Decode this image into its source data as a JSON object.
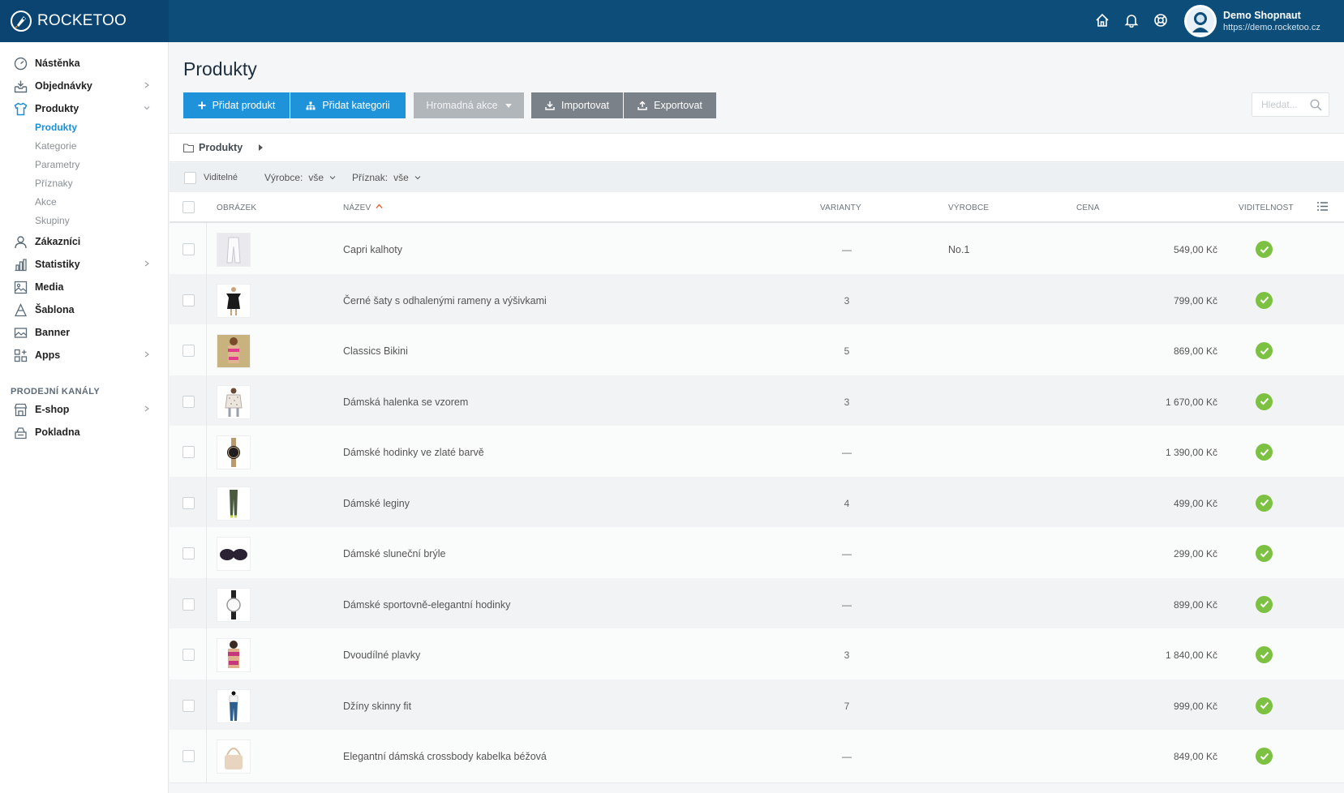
{
  "brand": {
    "name": "ROCKETOO"
  },
  "user": {
    "name": "Demo Shopnaut",
    "url": "https://demo.rocketoo.cz"
  },
  "sidebar": {
    "items": [
      {
        "label": "Nástěnka",
        "icon": "dashboard-icon"
      },
      {
        "label": "Objednávky",
        "icon": "inbox-icon"
      },
      {
        "label": "Produkty",
        "icon": "shirt-icon"
      },
      {
        "label": "Zákazníci",
        "icon": "user-icon"
      },
      {
        "label": "Statistiky",
        "icon": "bar-chart-icon"
      },
      {
        "label": "Media",
        "icon": "image-icon"
      },
      {
        "label": "Šablona",
        "icon": "template-icon"
      },
      {
        "label": "Banner",
        "icon": "banner-icon"
      },
      {
        "label": "Apps",
        "icon": "apps-icon"
      }
    ],
    "sub_items": [
      "Produkty",
      "Kategorie",
      "Parametry",
      "Příznaky",
      "Akce",
      "Skupiny"
    ],
    "channels_title": "PRODEJNÍ KANÁLY",
    "channels": [
      {
        "label": "E-shop",
        "icon": "store-icon"
      },
      {
        "label": "Pokladna",
        "icon": "cash-register-icon"
      }
    ]
  },
  "main": {
    "title": "Produkty",
    "buttons": {
      "add_product": "Přidat produkt",
      "add_category": "Přidat kategorii",
      "bulk_action": "Hromadná akce",
      "import": "Importovat",
      "export": "Exportovat"
    },
    "search_placeholder": "Hledat...",
    "breadcrumb": "Produkty",
    "filters": {
      "visible_label": "Viditelné",
      "manufacturer_label": "Výrobce:",
      "manufacturer_value": "vše",
      "flag_label": "Příznak:",
      "flag_value": "vše"
    },
    "columns": [
      "OBRÁZEK",
      "NÁZEV",
      "VARIANTY",
      "VÝROBCE",
      "CENA",
      "VIDITELNOST"
    ],
    "rows": [
      {
        "name": "Capri kalhoty",
        "variants": "—",
        "manufacturer": "No.1",
        "price": "549,00 Kč",
        "thumb": "pants-light"
      },
      {
        "name": "Černé šaty s odhalenými rameny a výšivkami",
        "variants": "3",
        "manufacturer": "",
        "price": "799,00 Kč",
        "thumb": "dress-black"
      },
      {
        "name": "Classics Bikini",
        "variants": "5",
        "manufacturer": "",
        "price": "869,00 Kč",
        "thumb": "bikini-pink"
      },
      {
        "name": "Dámská halenka se vzorem",
        "variants": "3",
        "manufacturer": "",
        "price": "1 670,00 Kč",
        "thumb": "blouse-pattern"
      },
      {
        "name": "Dámské hodinky ve zlaté barvě",
        "variants": "—",
        "manufacturer": "",
        "price": "1 390,00 Kč",
        "thumb": "watch-black"
      },
      {
        "name": "Dámské leginy",
        "variants": "4",
        "manufacturer": "",
        "price": "499,00 Kč",
        "thumb": "leggings"
      },
      {
        "name": "Dámské sluneční brýle",
        "variants": "—",
        "manufacturer": "",
        "price": "299,00 Kč",
        "thumb": "sunglasses"
      },
      {
        "name": "Dámské sportovně-elegantní hodinky",
        "variants": "—",
        "manufacturer": "",
        "price": "899,00 Kč",
        "thumb": "watch-white"
      },
      {
        "name": "Dvoudílné plavky",
        "variants": "3",
        "manufacturer": "",
        "price": "1 840,00 Kč",
        "thumb": "swimsuit"
      },
      {
        "name": "Džíny skinny fit",
        "variants": "7",
        "manufacturer": "",
        "price": "999,00 Kč",
        "thumb": "jeans"
      },
      {
        "name": "Elegantní dámská crossbody kabelka béžová",
        "variants": "—",
        "manufacturer": "",
        "price": "849,00 Kč",
        "thumb": "handbag-beige"
      }
    ]
  }
}
